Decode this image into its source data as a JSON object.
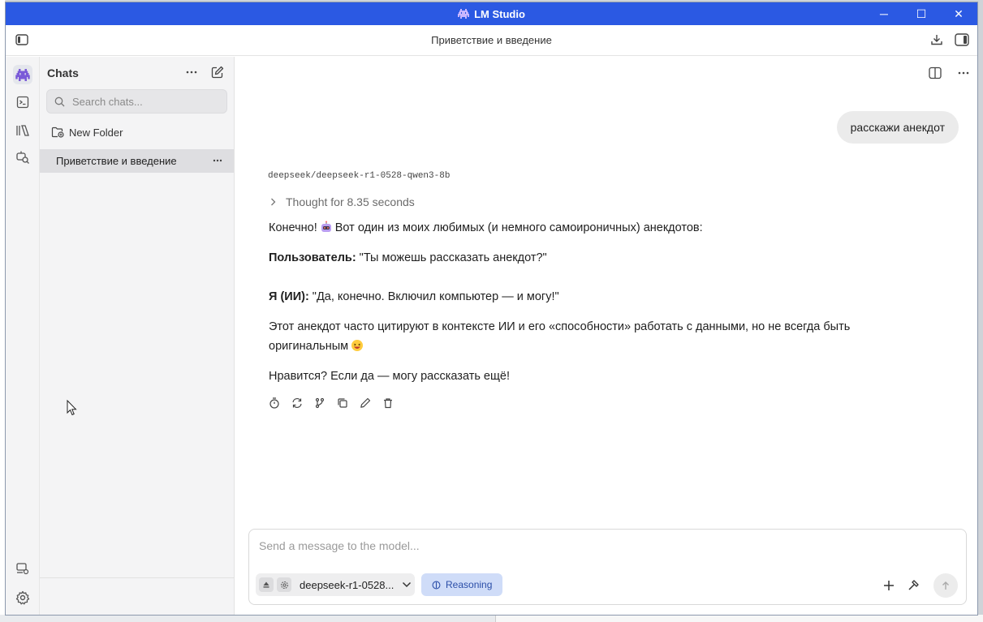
{
  "window": {
    "app_title": "LM Studio",
    "minimize": "─",
    "maximize": "☐",
    "close": "✕"
  },
  "toolbar": {
    "chat_title": "Приветствие и введение"
  },
  "sidebar": {
    "title": "Chats",
    "search_placeholder": "Search chats...",
    "new_folder_label": "New Folder",
    "chats": [
      {
        "label": "Приветствие и введение"
      }
    ]
  },
  "conversation": {
    "user_message": "расскажи анекдот",
    "model_name": "deepseek/deepseek-r1-0528-qwen3-8b",
    "thought_label": "Thought for 8.35 seconds",
    "paragraph1_before": "Конечно!",
    "paragraph1_after": "Вот один из моих любимых (и немного самоироничных) анекдотов:",
    "user_bold": "Пользователь:",
    "user_line": " \"Ты можешь рассказать анекдот?\"",
    "ai_bold": "Я (ИИ):",
    "ai_line": " \"Да, конечно. Включил компьютер — и могу!\"",
    "paragraph3": "Этот анекдот часто цитируют в контексте ИИ и его «способности» работать с данными, но не всегда быть оригинальным",
    "paragraph4": "Нравится? Если да — могу рассказать ещё!"
  },
  "composer": {
    "placeholder": "Send a message to the model...",
    "model_selected": "deepseek-r1-0528...",
    "reasoning_label": "Reasoning"
  },
  "colors": {
    "titlebar": "#2b59e3",
    "reasoning_bg": "#cfdcf8",
    "reasoning_text": "#2b4ea8",
    "accent_icon": "#7a5ad8"
  }
}
